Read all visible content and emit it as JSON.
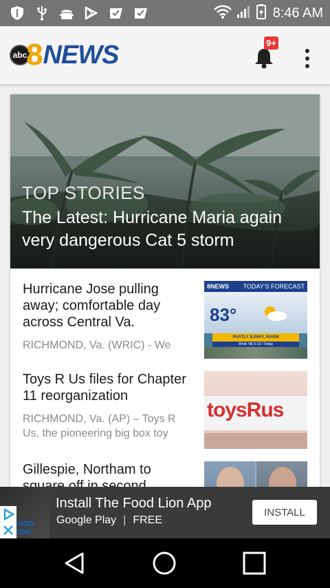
{
  "status_bar": {
    "time": "8:46 AM",
    "left_icons": [
      "shield-icon",
      "usb-icon",
      "android-debug-icon",
      "play-store-icon",
      "check-bookmark-icon",
      "check-bookmark-icon"
    ],
    "right_icons": [
      "wifi-icon",
      "signal-icon",
      "battery-icon"
    ]
  },
  "app_bar": {
    "logo_abc": "abc",
    "logo_number": "8",
    "logo_word": "NEWS",
    "notification_count": "9+"
  },
  "hero": {
    "section_label": "TOP STORIES",
    "headline": "The Latest: Hurricane Maria again very dangerous Cat 5 storm"
  },
  "stories": [
    {
      "title": "Hurricane Jose pulling away; comfortable day across Central Va.",
      "snippet": "RICHMOND, Va. (WRIC) - We",
      "thumb": {
        "banner_left": "8NEWS",
        "banner_right": "TODAY'S FORECAST",
        "temp": "83°",
        "caption": "PARTLY SUNNY, WARM",
        "subcaption": "Wind: NE 5-10 / Today"
      }
    },
    {
      "title": "Toys R Us files for Chapter 11 reorganization",
      "snippet": "RICHMOND, Va. (AP) – Toys R Us, the pioneering big box toy",
      "thumb": {
        "sign_text": "toysRus"
      }
    },
    {
      "title": "Gillespie, Northam to square off in second"
    }
  ],
  "ad": {
    "brand": "FOOD LION",
    "title": "Install The Food Lion App",
    "store": "Google Play",
    "separator": "|",
    "price": "FREE",
    "cta": "INSTALL"
  },
  "nav_bar": [
    "back-icon",
    "home-icon",
    "recents-icon"
  ],
  "colors": {
    "status_bar": "#757575",
    "app_bar": "#f5f5f5",
    "logo_blue": "#1e4f9c",
    "logo_gold": "#f0a500",
    "badge": "#e53935",
    "ad_bg": "#3a3a3a"
  }
}
